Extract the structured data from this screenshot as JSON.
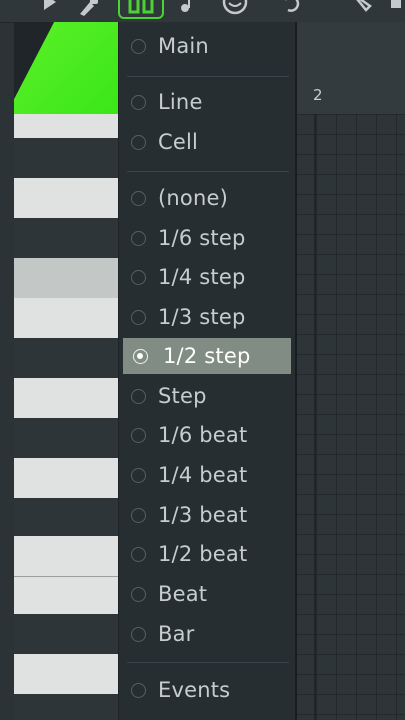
{
  "menu": {
    "items": [
      {
        "label": "Main",
        "selected": false
      },
      {
        "label": "Line",
        "selected": false
      },
      {
        "label": "Cell",
        "selected": false
      },
      {
        "label": "(none)",
        "selected": false
      },
      {
        "label": "1/6 step",
        "selected": false
      },
      {
        "label": "1/4 step",
        "selected": false
      },
      {
        "label": "1/3 step",
        "selected": false
      },
      {
        "label": "1/2 step",
        "selected": true
      },
      {
        "label": "Step",
        "selected": false
      },
      {
        "label": "1/6 beat",
        "selected": false
      },
      {
        "label": "1/4 beat",
        "selected": false
      },
      {
        "label": "1/3 beat",
        "selected": false
      },
      {
        "label": "1/2 beat",
        "selected": false
      },
      {
        "label": "Beat",
        "selected": false
      },
      {
        "label": "Bar",
        "selected": false
      },
      {
        "label": "Events",
        "selected": false
      }
    ]
  },
  "timeline": {
    "bar_number": "2"
  },
  "toolbar": {
    "icons": [
      "draw-tool-icon",
      "magnet-snap-icon",
      "note-icon",
      "smiley-icon",
      "undo-icon",
      "pencil-icon"
    ],
    "accent_color": "#4cd137"
  },
  "colors": {
    "highlight": "#818c84",
    "green_tab": "#4cea20"
  }
}
